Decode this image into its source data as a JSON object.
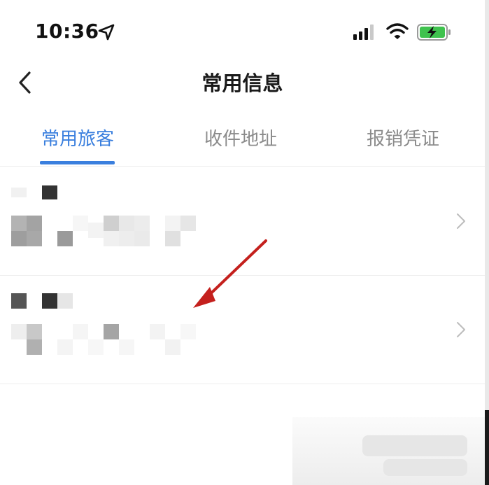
{
  "status_bar": {
    "time": "10:36",
    "icons": [
      "location-arrow-icon",
      "signal-icon",
      "wifi-icon",
      "battery-charging-icon"
    ]
  },
  "nav": {
    "back_icon": "chevron-left-icon",
    "title": "常用信息"
  },
  "tabs": [
    {
      "label": "常用旅客",
      "active": true
    },
    {
      "label": "收件地址",
      "active": false
    },
    {
      "label": "报销凭证",
      "active": false
    }
  ],
  "colors": {
    "accent": "#3a7fde",
    "annotation_arrow": "#c4201d",
    "text_primary": "#1a1a1a",
    "text_secondary": "#8b8b8b"
  },
  "list": {
    "item_icon": "chevron-right-icon",
    "item_count": 2
  }
}
